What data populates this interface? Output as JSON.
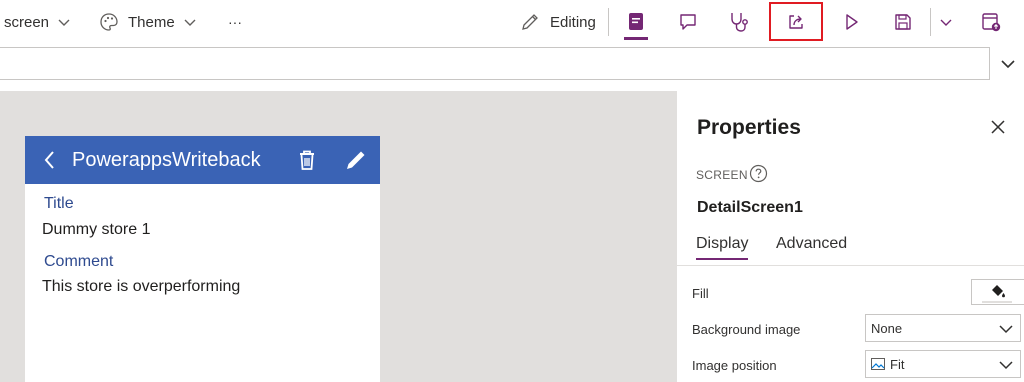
{
  "toolbar": {
    "screen_label": "screen",
    "theme_label": "Theme",
    "more_label": "···",
    "editing_label": "Editing"
  },
  "canvas": {
    "app_title": "PowerappsWriteback",
    "fields": [
      {
        "label": "Title",
        "value": "Dummy store 1"
      },
      {
        "label": "Comment",
        "value": "This store is overperforming"
      }
    ]
  },
  "properties": {
    "title": "Properties",
    "kind": "SCREEN",
    "screen_name": "DetailScreen1",
    "tabs": [
      "Display",
      "Advanced"
    ],
    "rows": [
      {
        "label": "Fill"
      },
      {
        "label": "Background image",
        "value": "None"
      },
      {
        "label": "Image position",
        "value": "Fit"
      }
    ]
  },
  "colors": {
    "accent": "#742774",
    "app_header": "#3a63b5",
    "highlight": "#e01b22"
  }
}
